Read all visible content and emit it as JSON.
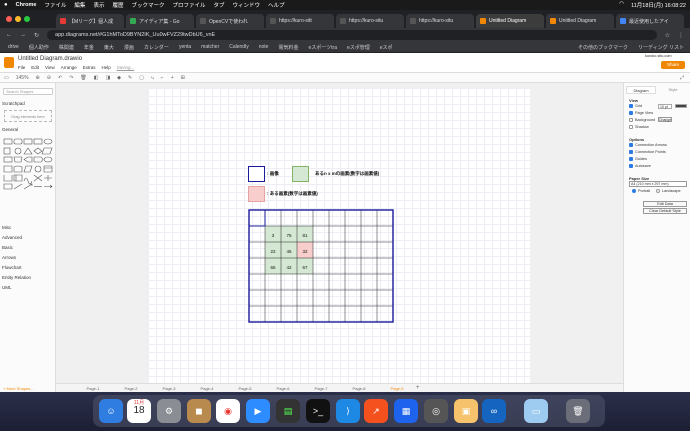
{
  "menubar": {
    "apple": "",
    "app": "Chrome",
    "items": [
      "ファイル",
      "編集",
      "表示",
      "履歴",
      "ブックマーク",
      "プロファイル",
      "タブ",
      "ウィンドウ",
      "ヘルプ"
    ],
    "clock": "11月18日(月)  16:08:22"
  },
  "browser_tabs": [
    {
      "title": "【Mリーグ】個人成",
      "color": "#e53935"
    },
    {
      "title": "アイディア集 - Go",
      "color": "#34a853"
    },
    {
      "title": "OpenCVで使われ",
      "color": "#444"
    },
    {
      "title": "https://kuro-sitt",
      "color": "#444"
    },
    {
      "title": "https://kuro-situ",
      "color": "#444"
    },
    {
      "title": "https://kuro-situ",
      "color": "#444"
    },
    {
      "title": "Untitled Diagram",
      "color": "#f08705"
    },
    {
      "title": "Untitled Diagram",
      "color": "#f08705"
    },
    {
      "title": "最近使用したアイ",
      "color": "#4285f4"
    }
  ],
  "address": {
    "url": "app.diagrams.net/#G1hMToD9BYN2IK_Uu0wFVZ29twDbU6_vnE"
  },
  "bookmarks": [
    "drive",
    "個人助作",
    "株関連",
    "年金",
    "東大",
    "漫画",
    "カレンダー",
    "yenta",
    "matcher",
    "Calendly",
    "note",
    "電気料金",
    "eスポーツtra",
    "eスポ管理",
    "eスポ",
    "その他のブックマーク",
    "リーディング リスト"
  ],
  "app": {
    "doc_name": "Untitled Diagram.drawio",
    "menu": [
      "File",
      "Edit",
      "View",
      "Arrange",
      "Extras",
      "Help",
      "Saving..."
    ],
    "share_label": "Share",
    "account": "kuroko.situ.com"
  },
  "toolbar": {
    "zoom": "145%"
  },
  "left_panel": {
    "search_placeholder": "Search Shapes",
    "scratchpad": "Scratchpad",
    "scratch_drop": "Drag elements here",
    "general": "General",
    "categories": [
      "Misc",
      "Advanced",
      "Basic",
      "Arrows",
      "Flowchart",
      "Entity Relation",
      "UML"
    ],
    "more_shapes": "+ More Shapes..."
  },
  "right_panel": {
    "tabs": [
      "Diagram",
      "Style"
    ],
    "view": "View",
    "grid": "Grid",
    "grid_size": "10 pt",
    "page_view": "Page View",
    "background": "Background",
    "change": "Change",
    "shadow": "Shadow",
    "options": "Options",
    "option_items": [
      "Connection Arrows",
      "Connection Points",
      "Guides",
      "Autosave"
    ],
    "paper_size": "Paper Size",
    "paper_value": "A4 (210 mm x 297 mm)",
    "portrait": "Portrait",
    "landscape": "Landscape",
    "edit_data": "Edit Data",
    "clear_style": "Clear Default Style"
  },
  "diagram": {
    "legend_image": ": 画像",
    "legend_filter": "あるn x mの画素(数字は画素値)",
    "legend_target": ": ある画素(数字は画素値)",
    "pixels": [
      [
        "3",
        "75",
        "81"
      ],
      [
        "22",
        "45",
        "32"
      ],
      [
        "65",
        "42",
        "67"
      ]
    ],
    "colors": {
      "border": "#1a1a9a",
      "green": "#d5e8d4",
      "red": "#f8cecc"
    }
  },
  "pages": [
    "Page-1",
    "Page-2",
    "Page-3",
    "Page-4",
    "Page-5",
    "Page-6",
    "Page-7",
    "Page-8",
    "Page-9"
  ],
  "dock": {
    "date_month": "11月",
    "date_day": "18"
  }
}
